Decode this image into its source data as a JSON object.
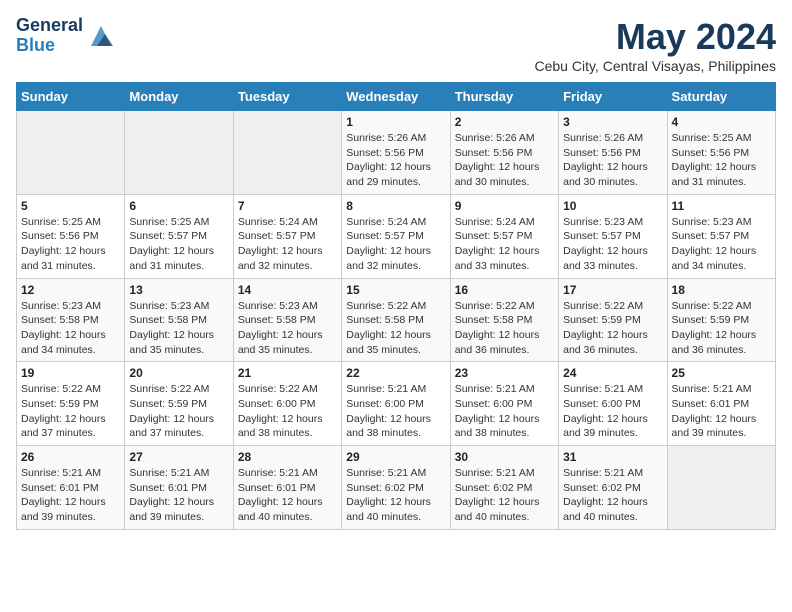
{
  "header": {
    "logo_general": "General",
    "logo_blue": "Blue",
    "title": "May 2024",
    "subtitle": "Cebu City, Central Visayas, Philippines"
  },
  "calendar": {
    "headers": [
      "Sunday",
      "Monday",
      "Tuesday",
      "Wednesday",
      "Thursday",
      "Friday",
      "Saturday"
    ],
    "weeks": [
      [
        {
          "day": "",
          "info": ""
        },
        {
          "day": "",
          "info": ""
        },
        {
          "day": "",
          "info": ""
        },
        {
          "day": "1",
          "info": "Sunrise: 5:26 AM\nSunset: 5:56 PM\nDaylight: 12 hours\nand 29 minutes."
        },
        {
          "day": "2",
          "info": "Sunrise: 5:26 AM\nSunset: 5:56 PM\nDaylight: 12 hours\nand 30 minutes."
        },
        {
          "day": "3",
          "info": "Sunrise: 5:26 AM\nSunset: 5:56 PM\nDaylight: 12 hours\nand 30 minutes."
        },
        {
          "day": "4",
          "info": "Sunrise: 5:25 AM\nSunset: 5:56 PM\nDaylight: 12 hours\nand 31 minutes."
        }
      ],
      [
        {
          "day": "5",
          "info": "Sunrise: 5:25 AM\nSunset: 5:56 PM\nDaylight: 12 hours\nand 31 minutes."
        },
        {
          "day": "6",
          "info": "Sunrise: 5:25 AM\nSunset: 5:57 PM\nDaylight: 12 hours\nand 31 minutes."
        },
        {
          "day": "7",
          "info": "Sunrise: 5:24 AM\nSunset: 5:57 PM\nDaylight: 12 hours\nand 32 minutes."
        },
        {
          "day": "8",
          "info": "Sunrise: 5:24 AM\nSunset: 5:57 PM\nDaylight: 12 hours\nand 32 minutes."
        },
        {
          "day": "9",
          "info": "Sunrise: 5:24 AM\nSunset: 5:57 PM\nDaylight: 12 hours\nand 33 minutes."
        },
        {
          "day": "10",
          "info": "Sunrise: 5:23 AM\nSunset: 5:57 PM\nDaylight: 12 hours\nand 33 minutes."
        },
        {
          "day": "11",
          "info": "Sunrise: 5:23 AM\nSunset: 5:57 PM\nDaylight: 12 hours\nand 34 minutes."
        }
      ],
      [
        {
          "day": "12",
          "info": "Sunrise: 5:23 AM\nSunset: 5:58 PM\nDaylight: 12 hours\nand 34 minutes."
        },
        {
          "day": "13",
          "info": "Sunrise: 5:23 AM\nSunset: 5:58 PM\nDaylight: 12 hours\nand 35 minutes."
        },
        {
          "day": "14",
          "info": "Sunrise: 5:23 AM\nSunset: 5:58 PM\nDaylight: 12 hours\nand 35 minutes."
        },
        {
          "day": "15",
          "info": "Sunrise: 5:22 AM\nSunset: 5:58 PM\nDaylight: 12 hours\nand 35 minutes."
        },
        {
          "day": "16",
          "info": "Sunrise: 5:22 AM\nSunset: 5:58 PM\nDaylight: 12 hours\nand 36 minutes."
        },
        {
          "day": "17",
          "info": "Sunrise: 5:22 AM\nSunset: 5:59 PM\nDaylight: 12 hours\nand 36 minutes."
        },
        {
          "day": "18",
          "info": "Sunrise: 5:22 AM\nSunset: 5:59 PM\nDaylight: 12 hours\nand 36 minutes."
        }
      ],
      [
        {
          "day": "19",
          "info": "Sunrise: 5:22 AM\nSunset: 5:59 PM\nDaylight: 12 hours\nand 37 minutes."
        },
        {
          "day": "20",
          "info": "Sunrise: 5:22 AM\nSunset: 5:59 PM\nDaylight: 12 hours\nand 37 minutes."
        },
        {
          "day": "21",
          "info": "Sunrise: 5:22 AM\nSunset: 6:00 PM\nDaylight: 12 hours\nand 38 minutes."
        },
        {
          "day": "22",
          "info": "Sunrise: 5:21 AM\nSunset: 6:00 PM\nDaylight: 12 hours\nand 38 minutes."
        },
        {
          "day": "23",
          "info": "Sunrise: 5:21 AM\nSunset: 6:00 PM\nDaylight: 12 hours\nand 38 minutes."
        },
        {
          "day": "24",
          "info": "Sunrise: 5:21 AM\nSunset: 6:00 PM\nDaylight: 12 hours\nand 39 minutes."
        },
        {
          "day": "25",
          "info": "Sunrise: 5:21 AM\nSunset: 6:01 PM\nDaylight: 12 hours\nand 39 minutes."
        }
      ],
      [
        {
          "day": "26",
          "info": "Sunrise: 5:21 AM\nSunset: 6:01 PM\nDaylight: 12 hours\nand 39 minutes."
        },
        {
          "day": "27",
          "info": "Sunrise: 5:21 AM\nSunset: 6:01 PM\nDaylight: 12 hours\nand 39 minutes."
        },
        {
          "day": "28",
          "info": "Sunrise: 5:21 AM\nSunset: 6:01 PM\nDaylight: 12 hours\nand 40 minutes."
        },
        {
          "day": "29",
          "info": "Sunrise: 5:21 AM\nSunset: 6:02 PM\nDaylight: 12 hours\nand 40 minutes."
        },
        {
          "day": "30",
          "info": "Sunrise: 5:21 AM\nSunset: 6:02 PM\nDaylight: 12 hours\nand 40 minutes."
        },
        {
          "day": "31",
          "info": "Sunrise: 5:21 AM\nSunset: 6:02 PM\nDaylight: 12 hours\nand 40 minutes."
        },
        {
          "day": "",
          "info": ""
        }
      ]
    ]
  }
}
